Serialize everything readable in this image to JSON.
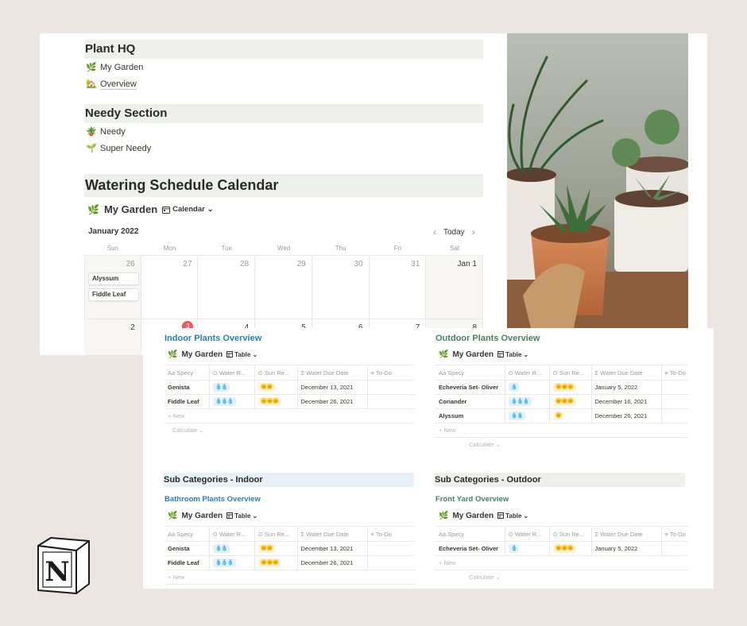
{
  "page": {
    "sections": {
      "plant_hq": "Plant HQ",
      "needy_section": "Needy Section",
      "calendar_section": "Watering Schedule Calendar"
    },
    "links": {
      "my_garden": {
        "emoji": "🌿",
        "label": "My Garden"
      },
      "overview": {
        "emoji": "🏡",
        "label": "Overview"
      },
      "needy": {
        "emoji": "🪴",
        "label": "Needy"
      },
      "super_needy": {
        "emoji": "🌱",
        "label": "Super Needy"
      }
    }
  },
  "calendar": {
    "db_emoji": "🌿",
    "db_title": "My Garden",
    "view_label": "Calendar",
    "month": "January 2022",
    "today_label": "Today",
    "weekdays": [
      "Sun",
      "Mon",
      "Tue",
      "Wed",
      "Thu",
      "Fri",
      "Sat"
    ],
    "week1": [
      "26",
      "27",
      "28",
      "29",
      "30",
      "31",
      "Jan 1"
    ],
    "week2": [
      "2",
      "3",
      "4",
      "5",
      "6",
      "7",
      "8"
    ],
    "events": [
      "Alyssum",
      "Fiddle Leaf"
    ]
  },
  "columns": {
    "specy": "Specy",
    "water": "Water R...",
    "sun": "Sun Re...",
    "due": "Water Due Date",
    "todo": "To-Do"
  },
  "common": {
    "db_emoji": "🌿",
    "db_title": "My Garden",
    "view_label": "Table",
    "new_label": "+ New",
    "calc_label": "Calculate ⌄"
  },
  "indoor": {
    "title": "Indoor Plants Overview",
    "rows": [
      {
        "name": "Genista",
        "water": "💧💧",
        "sun": "🌞🌞",
        "due": "December 13, 2021"
      },
      {
        "name": "Fiddle Leaf",
        "water": "💧💧💧",
        "sun": "🌞🌞🌞",
        "due": "December 26, 2021"
      }
    ]
  },
  "outdoor": {
    "title": "Outdoor Plants Overview",
    "rows": [
      {
        "name": "Echeveria Set- Oliver",
        "water": "💧",
        "sun": "🌞🌞🌞",
        "due": "January 5, 2022"
      },
      {
        "name": "Coriander",
        "water": "💧💧💧",
        "sun": "🌞🌞🌞",
        "due": "December 16, 2021"
      },
      {
        "name": "Alyssum",
        "water": "💧💧",
        "sun": "🌞",
        "due": "December 26, 2021"
      }
    ]
  },
  "sub_indoor": {
    "heading": "Sub Categories - Indoor",
    "title": "Bathroom Plants Overview",
    "rows": [
      {
        "name": "Genista",
        "water": "💧💧",
        "sun": "🌞🌞",
        "due": "December 13, 2021"
      },
      {
        "name": "Fiddle Leaf",
        "water": "💧💧💧",
        "sun": "🌞🌞🌞",
        "due": "December 26, 2021"
      }
    ]
  },
  "sub_outdoor": {
    "heading": "Sub Categories - Outdoor",
    "title": "Front Yard Overview",
    "rows": [
      {
        "name": "Echeveria Set- Oliver",
        "water": "💧",
        "sun": "🌞🌞🌞",
        "due": "January 5, 2022"
      }
    ]
  },
  "logo": {
    "letter": "N"
  },
  "colors": {
    "background": "#ece5e1",
    "section_bg": "#eef0eb",
    "sub_indoor_bg": "#e7f1f9",
    "blue_title": "#2b7fb0",
    "green_title": "#448361",
    "today_red": "#eb5757"
  }
}
